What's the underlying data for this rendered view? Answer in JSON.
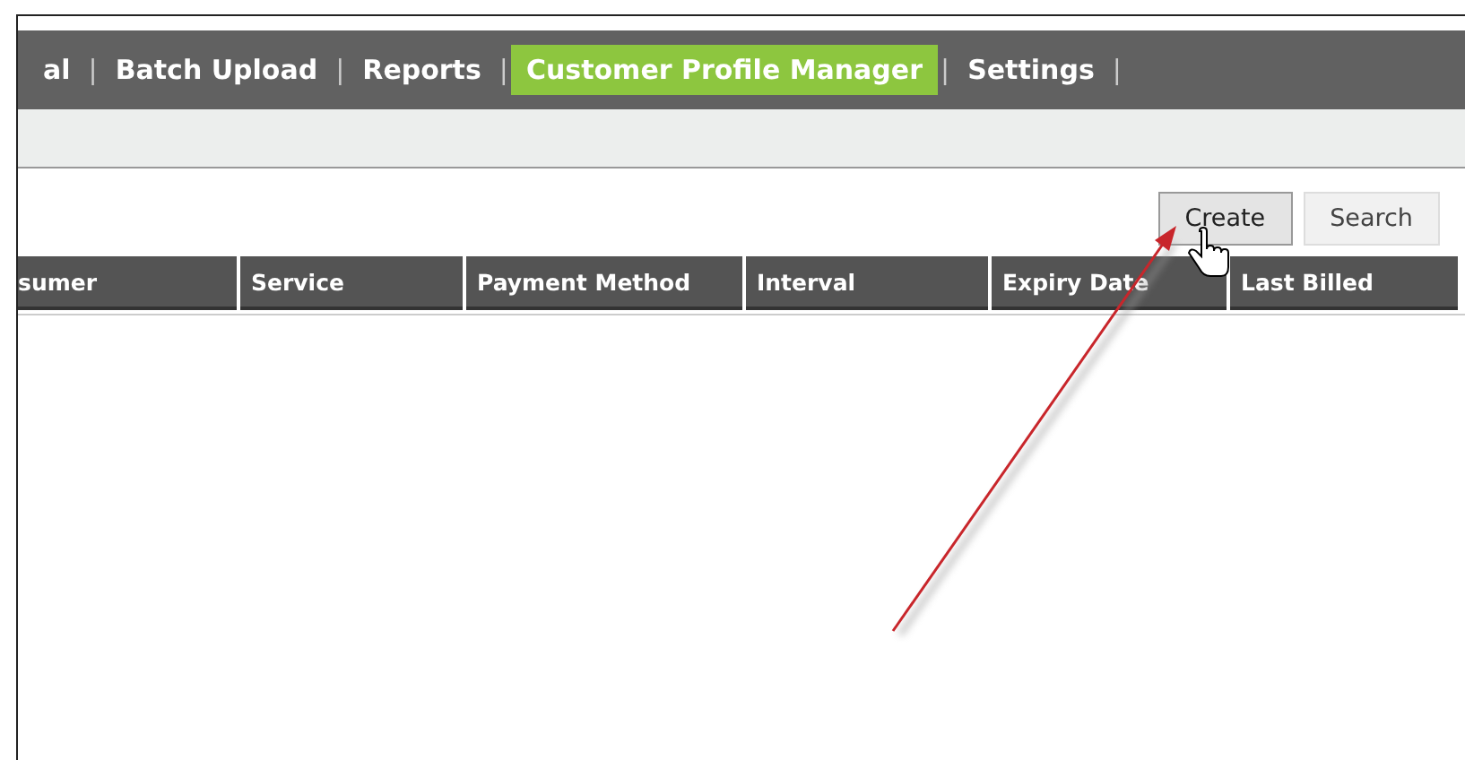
{
  "nav": [
    {
      "kind": "link",
      "label": "al",
      "selected": false
    },
    {
      "kind": "separator",
      "label": "|"
    },
    {
      "kind": "link",
      "label": "Batch Upload",
      "selected": false
    },
    {
      "kind": "separator",
      "label": "|"
    },
    {
      "kind": "link",
      "label": "Reports",
      "selected": false
    },
    {
      "kind": "separator",
      "label": "|"
    },
    {
      "kind": "link",
      "label": "Customer Profile Manager",
      "selected": true
    },
    {
      "kind": "separator",
      "label": "|"
    },
    {
      "kind": "link",
      "label": "Settings",
      "selected": false
    },
    {
      "kind": "separator",
      "label": "|"
    }
  ],
  "buttons": [
    {
      "label": "Create",
      "hovered": true
    },
    {
      "label": "Search",
      "hovered": false
    }
  ],
  "table": {
    "columns": [
      {
        "label": "sumer"
      },
      {
        "label": "Service"
      },
      {
        "label": "Payment Method"
      },
      {
        "label": "Interval"
      },
      {
        "label": "Expiry Date"
      },
      {
        "label": "Last Billed"
      }
    ]
  }
}
